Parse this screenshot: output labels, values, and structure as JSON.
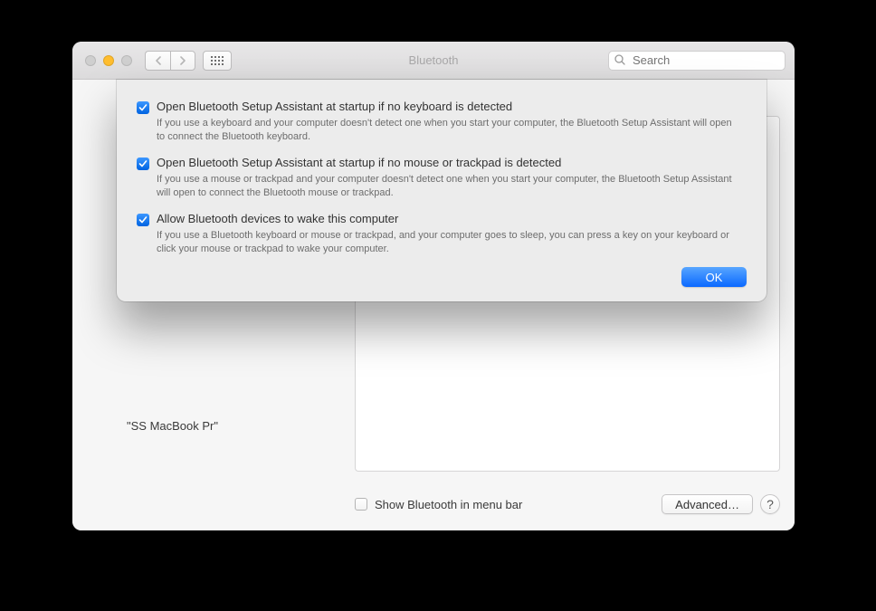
{
  "window": {
    "title": "Bluetooth"
  },
  "search": {
    "placeholder": "Search"
  },
  "device": {
    "name": "\"SS MacBook Pr\""
  },
  "footer": {
    "show_menu_bar": "Show Bluetooth in menu bar",
    "show_menu_bar_checked": false,
    "advanced_label": "Advanced…",
    "help_label": "?"
  },
  "sheet": {
    "options": [
      {
        "checked": true,
        "title": "Open Bluetooth Setup Assistant at startup if no keyboard is detected",
        "desc": "If you use a keyboard and your computer doesn't detect one when you start your computer, the Bluetooth Setup Assistant will open to connect the Bluetooth keyboard."
      },
      {
        "checked": true,
        "title": "Open Bluetooth Setup Assistant at startup if no mouse or trackpad is detected",
        "desc": "If you use a mouse or trackpad and your computer doesn't detect one when you start your computer, the Bluetooth Setup Assistant will open to connect the Bluetooth mouse or trackpad."
      },
      {
        "checked": true,
        "title": "Allow Bluetooth devices to wake this computer",
        "desc": "If you use a Bluetooth keyboard or mouse or trackpad, and your computer goes to sleep, you can press a key on your keyboard or click your mouse or trackpad to wake your computer."
      }
    ],
    "ok_label": "OK"
  }
}
